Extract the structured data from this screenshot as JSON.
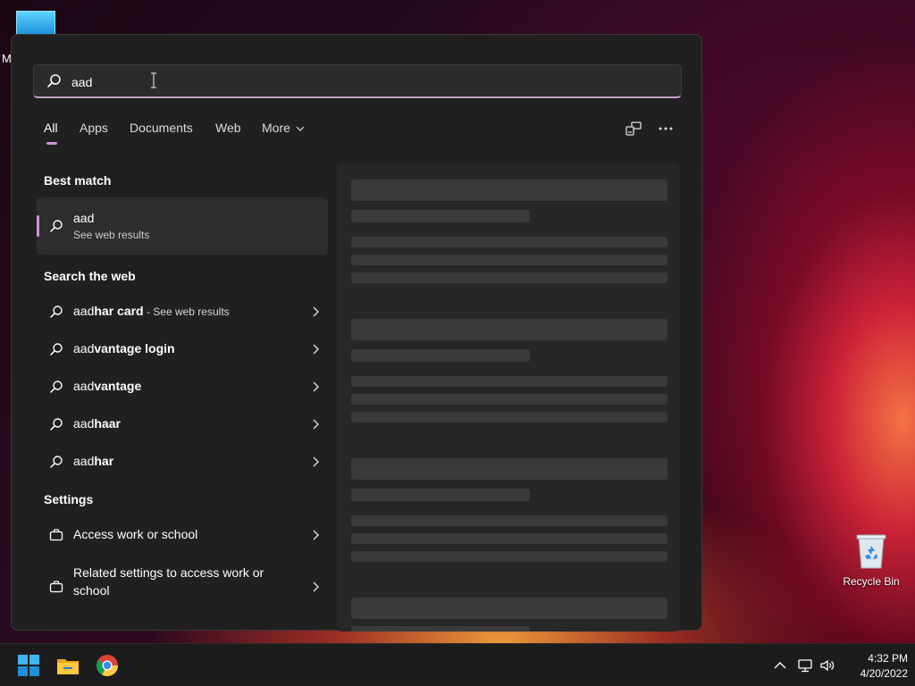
{
  "desktop": {
    "partial_icon_letter": "M",
    "recycle_bin_label": "Recycle Bin"
  },
  "search": {
    "query": "aad"
  },
  "tabs": [
    {
      "label": "All",
      "active": true
    },
    {
      "label": "Apps"
    },
    {
      "label": "Documents"
    },
    {
      "label": "Web"
    },
    {
      "label": "More"
    }
  ],
  "toolbar_icons": [
    "share-device-icon",
    "more-options-icon"
  ],
  "best_match": {
    "heading": "Best match",
    "title": "aad",
    "subtitle": "See web results"
  },
  "web": {
    "heading": "Search the web",
    "items": [
      {
        "prefix": "aad",
        "rest": "har card",
        "suffix": " - See web results"
      },
      {
        "prefix": "aad",
        "rest": "vantage login",
        "suffix": ""
      },
      {
        "prefix": "aad",
        "rest": "vantage",
        "suffix": ""
      },
      {
        "prefix": "aad",
        "rest": "haar",
        "suffix": ""
      },
      {
        "prefix": "aad",
        "rest": "har",
        "suffix": ""
      }
    ]
  },
  "settings": {
    "heading": "Settings",
    "items": [
      {
        "label": "Access work or school"
      },
      {
        "label": "Related settings to access work or school"
      }
    ]
  },
  "taskbar": {
    "apps": [
      "start-icon",
      "file-explorer-icon",
      "chrome-icon"
    ],
    "tray": [
      "chevron-up-icon",
      "network-icon",
      "volume-icon"
    ],
    "time": "4:32 PM",
    "date": "4/20/2022"
  },
  "colors": {
    "accent": "#c896d1",
    "panel_bg": "#202020",
    "taskbar_bg": "#1c1c1c"
  }
}
